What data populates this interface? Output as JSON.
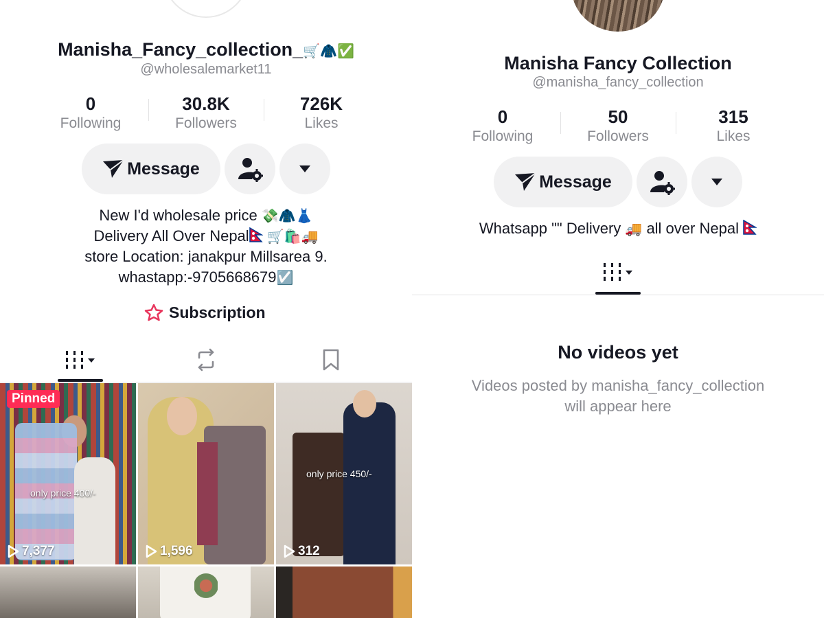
{
  "left": {
    "display_name": "Manisha_Fancy_collection_",
    "display_name_emoji": [
      "🛒",
      "🧥",
      "✅"
    ],
    "handle": "@wholesalemarket11",
    "stats": [
      {
        "value": "0",
        "label": "Following"
      },
      {
        "value": "30.8K",
        "label": "Followers"
      },
      {
        "value": "726K",
        "label": "Likes"
      }
    ],
    "message_label": "Message",
    "bio": {
      "line1": "New I'd wholesale price",
      "line1_emoji": "💸🧥👗",
      "line2": "Delivery All Over Nepal",
      "line2_emoji": "🛒🛍️🚚",
      "line3": "store Location: janakpur Millsarea 9.",
      "line4": "whastapp:-9705668679",
      "line4_emoji": "☑️"
    },
    "subscription_label": "Subscription",
    "pinned_label": "Pinned",
    "videos": [
      {
        "views": "7,377",
        "caption": "only price 400/-",
        "pinned": true
      },
      {
        "views": "1,596",
        "caption": ""
      },
      {
        "views": "312",
        "caption": "only price 450/-"
      }
    ]
  },
  "right": {
    "display_name": "Manisha Fancy Collection",
    "handle": "@manisha_fancy_collection",
    "stats": [
      {
        "value": "0",
        "label": "Following"
      },
      {
        "value": "50",
        "label": "Followers"
      },
      {
        "value": "315",
        "label": "Likes"
      }
    ],
    "message_label": "Message",
    "bio_text": "Whatsapp \"\" Delivery",
    "bio_emoji": "🚚",
    "bio_text2": "all over Nepal",
    "empty_title": "No videos yet",
    "empty_sub": "Videos posted by manisha_fancy_collection will appear here"
  },
  "colors": {
    "accent": "#fe2c55",
    "text_primary": "#161823",
    "text_secondary": "#8a8b91",
    "button_bg": "#f1f1f2"
  },
  "icons": [
    "send-icon",
    "add-friend-gear-icon",
    "dropdown-arrow-icon",
    "videos-grid-icon",
    "repost-icon",
    "bookmark-icon",
    "subscription-star-icon",
    "play-icon",
    "nepal-flag-icon"
  ]
}
